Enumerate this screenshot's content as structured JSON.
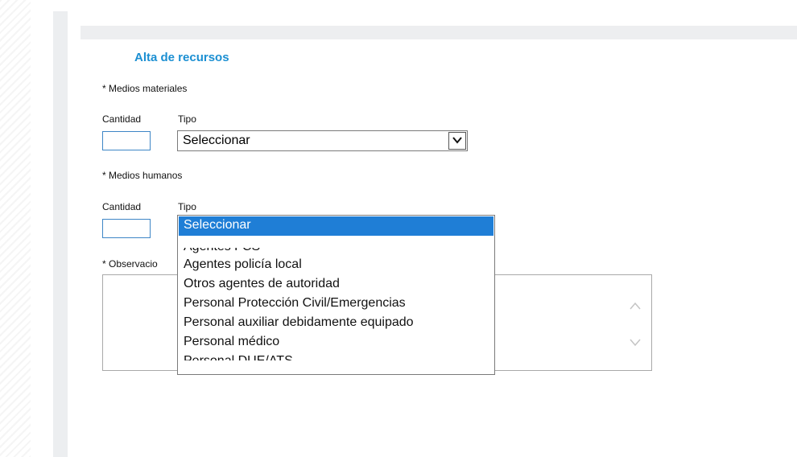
{
  "form": {
    "title": "Alta de recursos",
    "materials": {
      "section_label": "* Medios materiales",
      "quantity_label": "Cantidad",
      "type_label": "Tipo",
      "selected": "Seleccionar"
    },
    "humans": {
      "section_label": "* Medios humanos",
      "quantity_label": "Cantidad",
      "type_label": "Tipo"
    },
    "observations_label": "* Observacio"
  },
  "dropdown": {
    "options": [
      "Seleccionar",
      "Agentes FCS",
      "Agentes policía local",
      "Otros agentes de autoridad",
      "Personal Protección Civil/Emergencias",
      "Personal auxiliar debidamente equipado",
      "Personal médico",
      "Personal DUE/ATS"
    ],
    "selected_index": 0,
    "highlight_color": "#1f7ed6"
  },
  "icons": {
    "select_arrow": "chevron-down-icon",
    "scroll_up": "chevron-up-icon",
    "scroll_down": "chevron-down-icon"
  }
}
